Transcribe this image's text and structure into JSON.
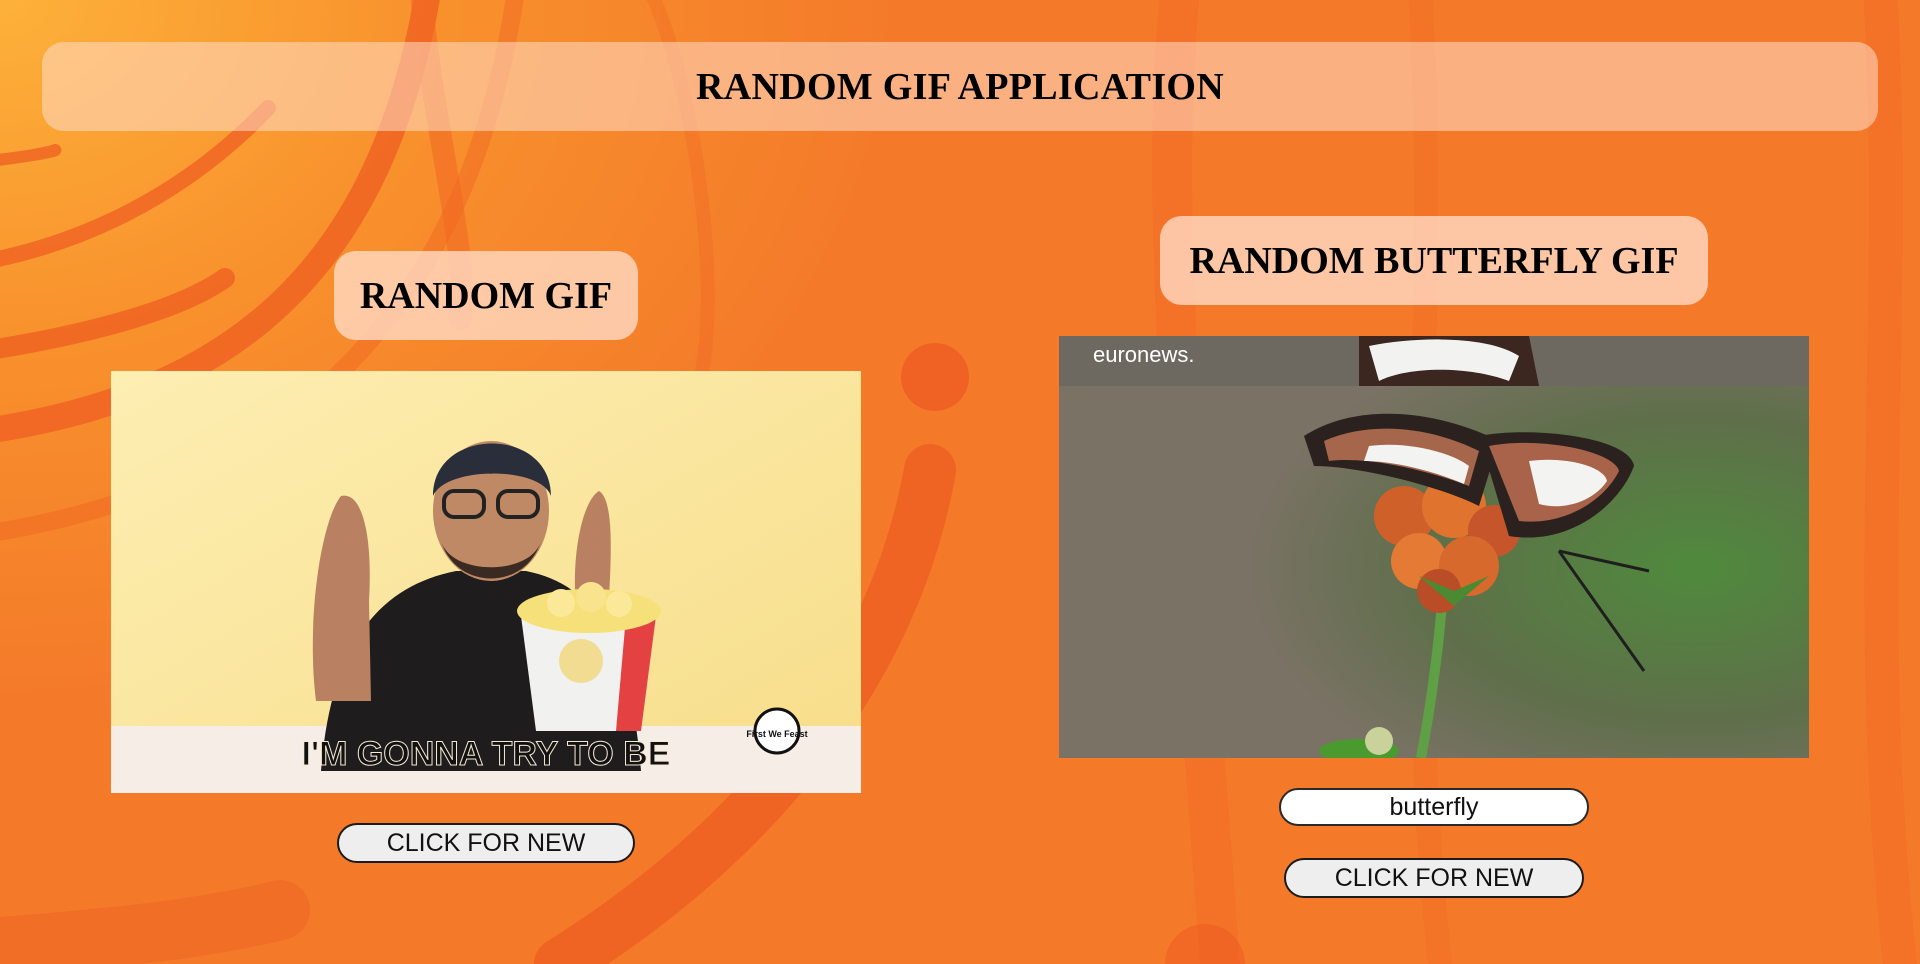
{
  "app": {
    "title": "RANDOM GIF APPLICATION"
  },
  "random_section": {
    "title": "RANDOM GIF",
    "gif_caption": "I'M GONNA TRY TO BE",
    "gif_watermark": "First We Feast",
    "button_label": "CLICK FOR NEW"
  },
  "tag_section": {
    "title": "RANDOM BUTTERFLY GIF",
    "gif_watermark": "euronews.",
    "search_value": "butterfly",
    "button_label": "CLICK FOR NEW"
  },
  "colors": {
    "background": "#f47a2a",
    "panel": "#fcd3bd",
    "button_bg": "#eeeeee"
  }
}
